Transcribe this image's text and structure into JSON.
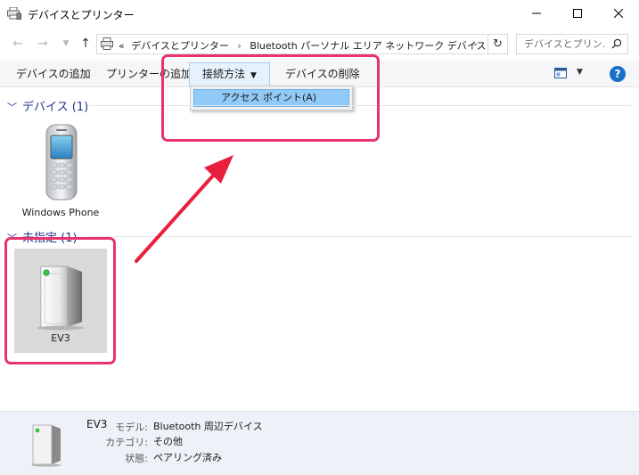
{
  "window": {
    "title": "デバイスとプリンター"
  },
  "address": {
    "overflow": "«",
    "crumbs": [
      "デバイスとプリンター",
      "Bluetooth パーソナル エリア ネットワーク デバイス"
    ],
    "search_placeholder": "デバイスとプリン..."
  },
  "commandbar": {
    "add_device": "デバイスの追加",
    "add_printer": "プリンターの追加",
    "connect_using": "接続方法",
    "remove_device": "デバイスの削除"
  },
  "menu": {
    "access_point": "アクセス ポイント(A)"
  },
  "groups": {
    "devices": {
      "label": "デバイス (1)"
    },
    "unspecified": {
      "label": "未指定 (1)"
    }
  },
  "devices": {
    "phone": "Windows Phone",
    "ev3": "EV3"
  },
  "status": {
    "name": "EV3",
    "model_label": "モデル:",
    "model_value": "Bluetooth 周辺デバイス",
    "category_label": "カテゴリ:",
    "category_value": "その他",
    "state_label": "状態:",
    "state_value": "ペアリング済み"
  },
  "colors": {
    "accent": "#1e3287",
    "highlight": "#e8336d",
    "arrow": "#e8203c",
    "menu_selected": "#91c9f7",
    "status_bg": "#eef2f8"
  },
  "icons": [
    "printer-devices-icon",
    "minimize-icon",
    "maximize-icon",
    "close-icon",
    "back-arrow-icon",
    "forward-arrow-icon",
    "up-arrow-icon",
    "refresh-icon",
    "search-icon",
    "view-options-icon",
    "help-icon",
    "phone-device-icon",
    "ev3-device-icon"
  ]
}
